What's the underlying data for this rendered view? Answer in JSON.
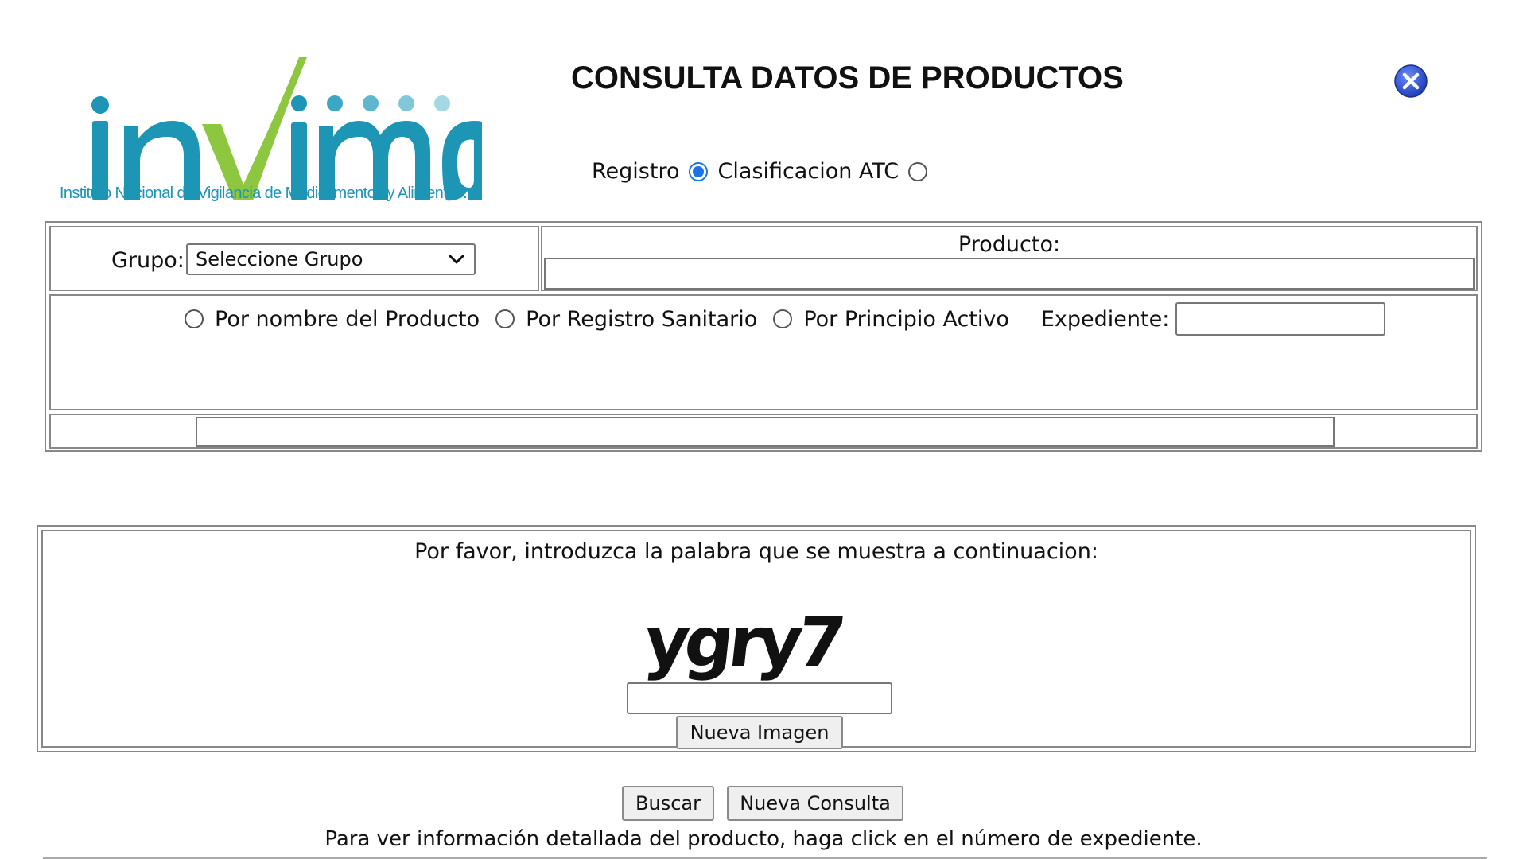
{
  "logo": {
    "wordmark": "invima",
    "tagline": "Instituto Nacional de Vigilancia de Medicamentos y Alimentos."
  },
  "title": "CONSULTA DATOS DE PRODUCTOS",
  "close_icon": "close-x-circle-icon",
  "search_type": {
    "options": [
      "Registro",
      "Clasificacion ATC"
    ],
    "selected": "Registro"
  },
  "form": {
    "grupo_label": "Grupo:",
    "grupo_select_value": "Seleccione Grupo",
    "producto_label": "Producto:",
    "producto_value": "",
    "filters": [
      "Por nombre del Producto",
      "Por Registro Sanitario",
      "Por Principio Activo"
    ],
    "expediente_label": "Expediente:",
    "expediente_value": "",
    "bottom_value": ""
  },
  "captcha": {
    "prompt": "Por favor, introduzca la palabra que se muestra a continuacion:",
    "image_text": "ygry7",
    "input_value": "",
    "new_image_label": "Nueva Imagen"
  },
  "actions": {
    "search_label": "Buscar",
    "new_query_label": "Nueva Consulta"
  },
  "footer_note": "Para ver información detallada del producto, haga click en el número de expediente.",
  "colors": {
    "logo_teal": "#1d95b5",
    "logo_green": "#8dc63f",
    "radio_accent": "#1a73e8",
    "close_blue": "#1f3fb8"
  }
}
